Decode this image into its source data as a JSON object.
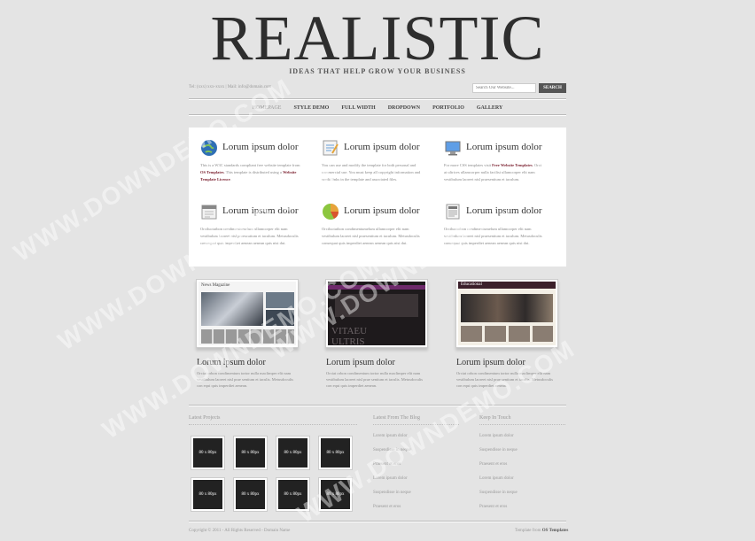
{
  "header": {
    "logo": "REALISTIC",
    "tagline": "IDEAS THAT HELP GROW YOUR BUSINESS",
    "contact": "Tel: (xxx) xxx-xxxx | Mail: info@domain.com",
    "search_placeholder": "Search Our Website...",
    "search_button": "SEARCH"
  },
  "nav": {
    "items": [
      "HOMEPAGE",
      "STYLE DEMO",
      "FULL WIDTH",
      "DROPDOWN",
      "PORTFOLIO",
      "GALLERY"
    ]
  },
  "features": [
    {
      "title": "Lorum ipsum dolor",
      "text_a": "This is a W3C standards compliant free website template from ",
      "link_a": "OS Templates",
      "text_b": ". This template is distributed using a ",
      "link_b": "Website Template Licence",
      "text_c": "."
    },
    {
      "title": "Lorum ipsum dolor",
      "text_a": "You can use and modify the template for both personal and commercial use. You must keep all copyright information and credit links in the template and associated files.",
      "link_a": "",
      "text_b": "",
      "link_b": "",
      "text_c": ""
    },
    {
      "title": "Lorum ipsum dolor",
      "text_a": "For more CSS templates visit ",
      "link_a": "Free Website Templates",
      "text_b": ". Orci at ultrices ullamcorper nulla facilisi ullamcorper elit nam vestibulum laoreet nisl praesentium et iaculum.",
      "link_b": "",
      "text_c": ""
    },
    {
      "title": "Lorum ipsum dolor",
      "text_a": "Orciluctutbon condimentumelum ullamcorper elit nam vestibulum laoreet nisl praesentium et iaculum. Metusdoculis consequat quis imperdiet aenean aenean quis nisi dui.",
      "link_a": "",
      "text_b": "",
      "link_b": "",
      "text_c": ""
    },
    {
      "title": "Lorum ipsum dolor",
      "text_a": "Orciluctutbon condimentumelum ullamcorper elit nam vestibulum laoreet nisl praesentium et iaculum. Metusdoculis consequat quis imperdiet aenean aenean quis nisi dui.",
      "link_a": "",
      "text_b": "",
      "link_b": "",
      "text_c": ""
    },
    {
      "title": "Lorum ipsum dolor",
      "text_a": "Orciluctutbon condimentumelum ullamcorper elit nam vestibulum laoreet nisl praesentium et iaculum. Metusdoculis consequat quis imperdiet aenean aenean quis nisi dui.",
      "link_a": "",
      "text_b": "",
      "link_b": "",
      "text_c": ""
    }
  ],
  "feature_icons": [
    "globe-icon",
    "notepad-icon",
    "monitor-icon",
    "calendar-icon",
    "pie-chart-icon",
    "newspaper-icon"
  ],
  "portfolio": [
    {
      "title": "Lorum ipsum dolor",
      "text": "Orciat orbon condimentum tortor nulla maclimper elit nam vestibulum laoreet nisl prae sentium et iaculis. Metusdoculis con equi quis imperdiet aenean."
    },
    {
      "title": "Lorum ipsum dolor",
      "text": "Orciat orbon condimentum tortor nulla maclimper elit nam vestibulum laoreet nisl prae sentium et iaculis. Metusdoculis con equi quis imperdiet aenean."
    },
    {
      "title": "Lorum ipsum dolor",
      "text": "Orciat orbon condimentum tortor nulla maclimper elit nam vestibulum laoreet nisl prae sentium et iaculis. Metusdoculis con equi quis imperdiet aenean."
    }
  ],
  "thumb_labels": {
    "news": "News Magazine",
    "vitaeu": "VITAEU",
    "ultris": "ULTRIS",
    "edu": "Educational"
  },
  "latest_projects": {
    "heading": "Latest Projects",
    "tiles": [
      "80 x 80px",
      "80 x 80px",
      "80 x 80px",
      "80 x 80px",
      "80 x 80px",
      "80 x 80px",
      "80 x 80px",
      "80 x 80px"
    ]
  },
  "blog": {
    "heading": "Latest From The Blog",
    "links": [
      "Lorem ipsum dolor",
      "Suspendisse in neque",
      "Praesent et eros",
      "Lorem ipsum dolor",
      "Suspendisse in neque",
      "Praesent et eros"
    ]
  },
  "touch": {
    "heading": "Keep In Touch",
    "links": [
      "Lorem ipsum dolor",
      "Suspendisse in neque",
      "Praesent et eros",
      "Lorem ipsum dolor",
      "Suspendisse in neque",
      "Praesent et eros"
    ]
  },
  "footer": {
    "copyright": "Copyright © 2011 - All Rights Reserved - Domain Name",
    "template_prefix": "Template from ",
    "template_link": "OS Templates"
  },
  "watermark": "WWW.DOWNDEMO.COM",
  "colors": {
    "link": "#7a1f2e",
    "tile": "#222222",
    "panel": "#ffffff",
    "background": "#e4e4e4"
  }
}
